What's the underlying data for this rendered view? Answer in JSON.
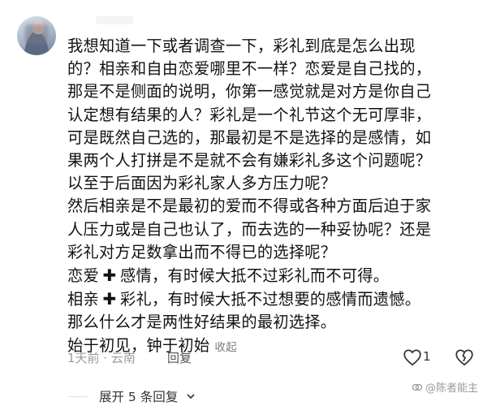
{
  "comment": {
    "lines": [
      "我想知道一下或者调查一下，彩礼到底是怎么出现",
      "的？相亲和自由恋爱哪里不一样？恋爱是自己找的，",
      "那是不是侧面的说明，你第一感觉就是对方是你自己",
      "认定想有结果的人？彩礼是一个礼节这个无可厚非，",
      "可是既然自己选的，那最初是不是选择的是感情，如",
      "果两个人打拼是不是就不会有嫌彩礼多这个问题呢？",
      "以至于后面因为彩礼家人多方压力呢？",
      "然后相亲是不是最初的爱而不得或各种方面后迫于家",
      "人压力或是自己也认了，而去选的一种妥协呢？还是",
      "彩礼对方足数拿出而不得已的选择呢？"
    ],
    "formula1": {
      "left": "恋爱",
      "right": "感情，有时候大抵不过彩礼而不可得。"
    },
    "formula2": {
      "left": "相亲",
      "right": "彩礼，有时候大抵不过想要的感情而遗憾。"
    },
    "line_final1": "那么什么才是两性好结果的最初选择。",
    "line_final2": "始于初见，钟于初始",
    "collapse_label": "收起"
  },
  "meta": {
    "time_location": "1天前 · 云南",
    "reply_label": "回复",
    "like_count": "1"
  },
  "expand_label": "展开 5 条回复",
  "watermark": "@陈者能主",
  "icons": {
    "plus": "plus-icon",
    "like": "heart-outline-icon",
    "dislike": "broken-heart-icon",
    "chevron": "chevron-down-icon"
  }
}
